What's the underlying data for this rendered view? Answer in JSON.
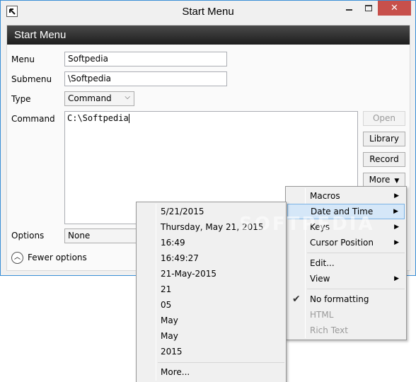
{
  "window": {
    "title": "Start Menu"
  },
  "panel": {
    "header": "Start Menu"
  },
  "form": {
    "menu_label": "Menu",
    "menu_value": "Softpedia",
    "submenu_label": "Submenu",
    "submenu_value": "\\Softpedia",
    "type_label": "Type",
    "type_value": "Command",
    "command_label": "Command",
    "command_value": "C:\\Softpedia",
    "options_label": "Options",
    "options_value": "None",
    "fewer_options": "Fewer options"
  },
  "buttons": {
    "open": "Open",
    "library": "Library",
    "record": "Record",
    "more": "More"
  },
  "more_menu": {
    "items": [
      {
        "label": "Macros",
        "submenu": true
      },
      {
        "label": "Date and Time",
        "submenu": true,
        "highlighted": true
      },
      {
        "label": "Keys",
        "submenu": true
      },
      {
        "label": "Cursor Position",
        "submenu": true
      },
      {
        "label": "Edit...",
        "submenu": false
      },
      {
        "label": "View",
        "submenu": true
      },
      {
        "label": "No formatting",
        "checked": true
      },
      {
        "label": "HTML",
        "disabled": true
      },
      {
        "label": "Rich Text",
        "disabled": true
      }
    ]
  },
  "datetime_menu": {
    "items": [
      "5/21/2015",
      "Thursday, May 21, 2015",
      "16:49",
      "16:49:27",
      "21-May-2015",
      "21",
      "05",
      "May",
      "May",
      "2015"
    ],
    "more": "More..."
  },
  "watermark": "SOFTPEDIA",
  "icons": {
    "app": "arrow-up-left-icon",
    "submenu": "triangle-right-icon",
    "check": "checkmark-icon",
    "collapse": "chevron-up-icon"
  },
  "colors": {
    "window_border": "#3a8fd6",
    "close_button": "#c7504b",
    "header_band": "#2b2b2b",
    "menu_highlight": "#d5e7f8"
  }
}
